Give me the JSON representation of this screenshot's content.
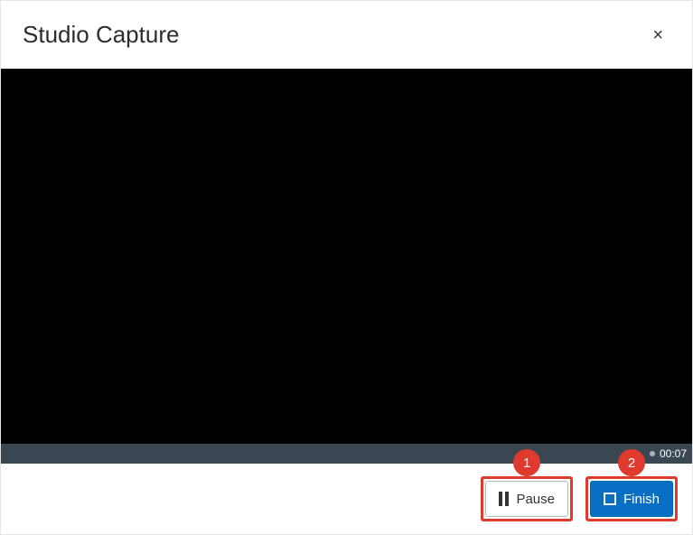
{
  "header": {
    "title": "Studio Capture",
    "close_label": "×"
  },
  "status": {
    "timer": "00:07"
  },
  "controls": {
    "pause_label": "Pause",
    "finish_label": "Finish"
  },
  "annotations": {
    "badge1": "1",
    "badge2": "2"
  }
}
